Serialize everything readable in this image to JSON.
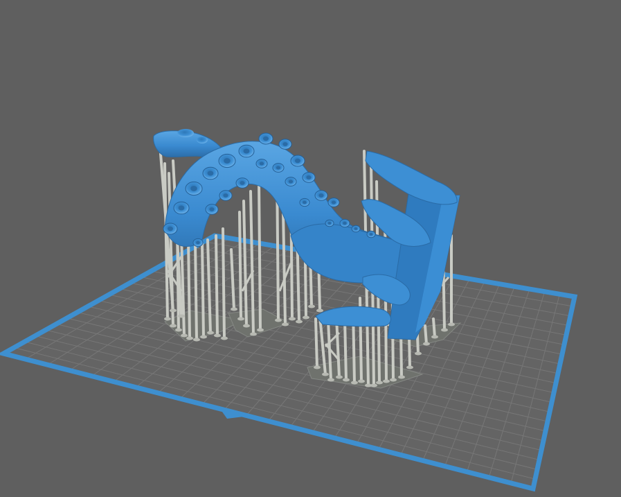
{
  "viewport": {
    "background_color": "#5f5f5f",
    "build_plate": {
      "border_color": "#3e8fcf",
      "grid_color": "#757575",
      "fill_color": "#636363",
      "front_marker_color": "#3e8fcf"
    },
    "model": {
      "description_icon": "octopus-tentacle-model",
      "color": "#3d8fd4",
      "shadow_color": "#2a6ba6",
      "highlight_color": "#78b9ec"
    },
    "supports": {
      "color": "#c9cbc4",
      "shadow_color": "#9ea09a",
      "raft_color": "#7b7e79"
    }
  }
}
